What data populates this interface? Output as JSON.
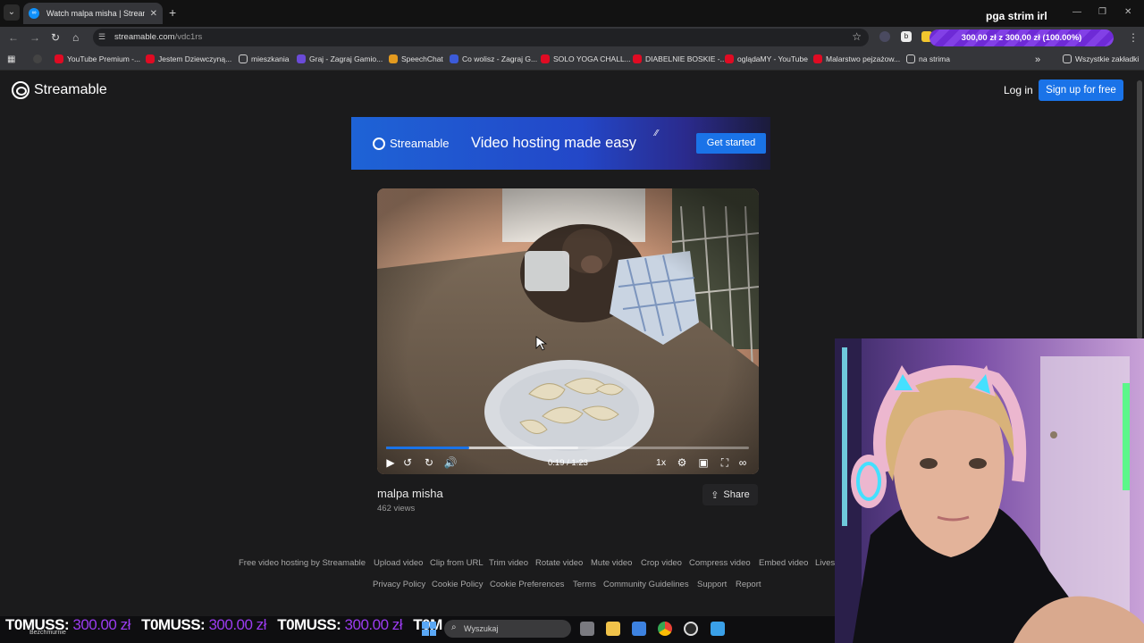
{
  "browser": {
    "tab_title": "Watch malpa misha | Streamable",
    "url_host": "streamable.com",
    "url_path": "/vdc1rs",
    "stream_title": "pga strim irl",
    "donation_goal": "300,00 zł z 300,00 zł (100.00%)",
    "bookmarks": [
      {
        "label": "YouTube Premium -...",
        "icon": "youtube-icon"
      },
      {
        "label": "Jestem Dziewczyną...",
        "icon": "youtube-icon"
      },
      {
        "label": "mieszkania",
        "icon": "folder-icon"
      },
      {
        "label": "Graj - Zagraj Gamio...",
        "icon": "game-icon"
      },
      {
        "label": "SpeechChat",
        "icon": "speech-icon"
      },
      {
        "label": "Co wolisz - Zagraj G...",
        "icon": "game-icon"
      },
      {
        "label": "SOLO YOGA CHALL...",
        "icon": "youtube-icon"
      },
      {
        "label": "DIABELNIE BOSKIE -...",
        "icon": "youtube-icon"
      },
      {
        "label": "oglądaMY - YouTube",
        "icon": "youtube-icon"
      },
      {
        "label": "Malarstwo pejzażow...",
        "icon": "youtube-icon"
      },
      {
        "label": "na strima",
        "icon": "folder-icon"
      }
    ],
    "all_bookmarks": "Wszystkie zakładki"
  },
  "site": {
    "brand": "Streamable",
    "login": "Log in",
    "signup": "Sign up for free"
  },
  "banner": {
    "brand": "Streamable",
    "tagline": "Video hosting made easy",
    "cta": "Get started"
  },
  "video": {
    "title": "malpa misha",
    "views": "462 views",
    "time": "0:19 / 1:23",
    "speed": "1x",
    "progress": 0.23,
    "buffered": 0.53,
    "share": "Share"
  },
  "footer": {
    "row1": [
      "Free video hosting by Streamable",
      "Upload video",
      "Clip from URL",
      "Trim video",
      "Rotate video",
      "Mute video",
      "Crop video",
      "Compress video",
      "Embed video",
      "Lives"
    ],
    "row2": [
      "Privacy Policy",
      "Cookie Policy",
      "Cookie Preferences",
      "Terms",
      "Community Guidelines",
      "Support",
      "Report"
    ]
  },
  "overlay": {
    "ticker": [
      {
        "name": "T0MUSS:",
        "amount": "300.00 zł"
      },
      {
        "name": "T0MUSS:",
        "amount": "300.00 zł"
      },
      {
        "name": "T0MUSS:",
        "amount": "300.00 zł"
      },
      {
        "name": "T0M",
        "amount": ""
      }
    ],
    "under_ticker": "Bezchmurnie"
  },
  "taskbar": {
    "search_placeholder": "Wyszukaj"
  }
}
